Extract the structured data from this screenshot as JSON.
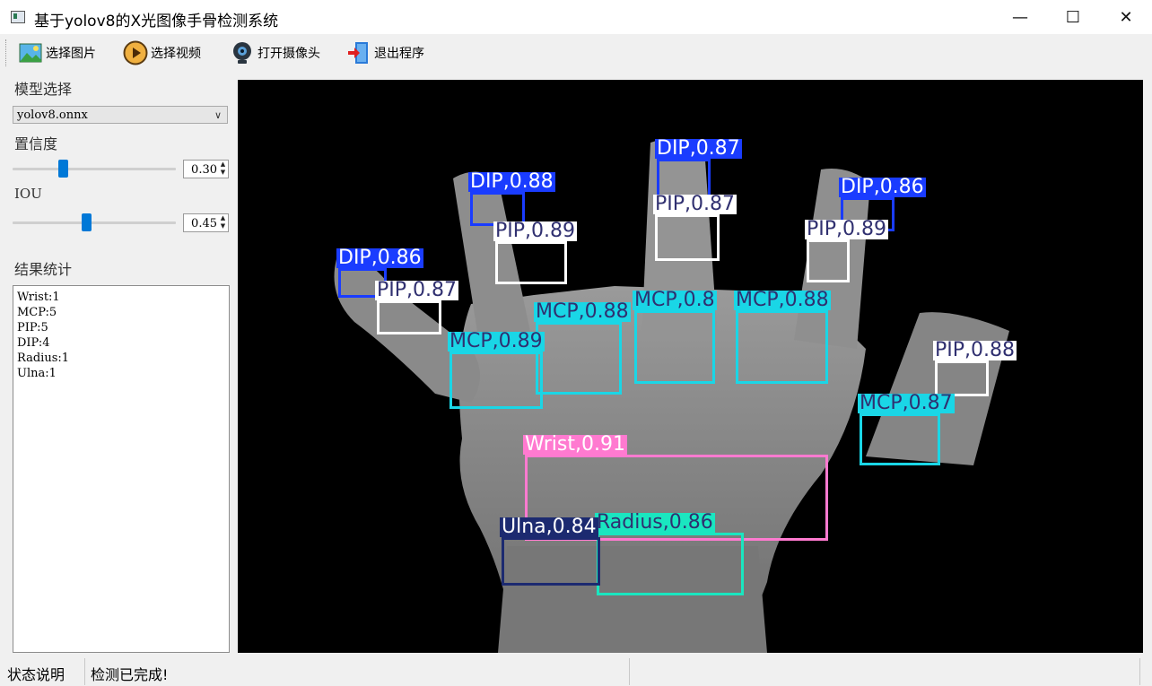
{
  "window": {
    "title": "基于yolov8的X光图像手骨检测系统",
    "minimize_glyph": "—",
    "maximize_glyph": "☐",
    "close_glyph": "✕"
  },
  "toolbar": {
    "items": [
      {
        "label": "选择图片",
        "icon": "image-icon"
      },
      {
        "label": "选择视频",
        "icon": "play-icon"
      },
      {
        "label": "打开摄像头",
        "icon": "webcam-icon"
      },
      {
        "label": "退出程序",
        "icon": "exit-icon"
      }
    ]
  },
  "sidebar": {
    "model_label": "模型选择",
    "model_value": "yolov8.onnx",
    "confidence_label": "置信度",
    "confidence_value": "0.30",
    "confidence_level": 0.3,
    "iou_label": "IOU",
    "iou_value": "0.45",
    "iou_level": 0.45,
    "results_label": "结果统计",
    "results": [
      "Wrist:1",
      "MCP:5",
      "PIP:5",
      "DIP:4",
      "Radius:1",
      "Ulna:1"
    ]
  },
  "detections": [
    {
      "label": "DIP,0.88",
      "color": "#1a3cff",
      "text_color": "#ffffff"
    },
    {
      "label": "DIP,0.86",
      "color": "#1a3cff",
      "text_color": "#ffffff"
    },
    {
      "label": "DIP,0.87",
      "color": "#1a3cff",
      "text_color": "#ffffff"
    },
    {
      "label": "DIP,0.86",
      "color": "#1a3cff",
      "text_color": "#ffffff"
    },
    {
      "label": "PIP,0.87",
      "color": "#ffffff",
      "text_color": "#303070"
    },
    {
      "label": "PIP,0.89",
      "color": "#ffffff",
      "text_color": "#303070"
    },
    {
      "label": "PIP,0.89",
      "color": "#ffffff",
      "text_color": "#303070"
    },
    {
      "label": "PIP,0.87",
      "color": "#ffffff",
      "text_color": "#303070"
    },
    {
      "label": "PIP,0.88",
      "color": "#ffffff",
      "text_color": "#303070"
    },
    {
      "label": "MCP,0.8",
      "color": "#1ad6e6",
      "text_color": "#303070"
    },
    {
      "label": "MCP,0.88",
      "color": "#1ad6e6",
      "text_color": "#303070"
    },
    {
      "label": "MCP,0.88",
      "color": "#1ad6e6",
      "text_color": "#303070"
    },
    {
      "label": "MCP,0.89",
      "color": "#1ad6e6",
      "text_color": "#303070"
    },
    {
      "label": "MCP,0.87",
      "color": "#1ad6e6",
      "text_color": "#303070"
    },
    {
      "label": "Wrist,0.91",
      "color": "#ff7ad0",
      "text_color": "#ffffff"
    },
    {
      "label": "Radius,0.86",
      "color": "#1ae6c0",
      "text_color": "#303070"
    },
    {
      "label": "Ulna,0.84",
      "color": "#1c2a70",
      "text_color": "#ffffff"
    }
  ],
  "status": {
    "label": "状态说明",
    "message": "检测已完成!"
  }
}
